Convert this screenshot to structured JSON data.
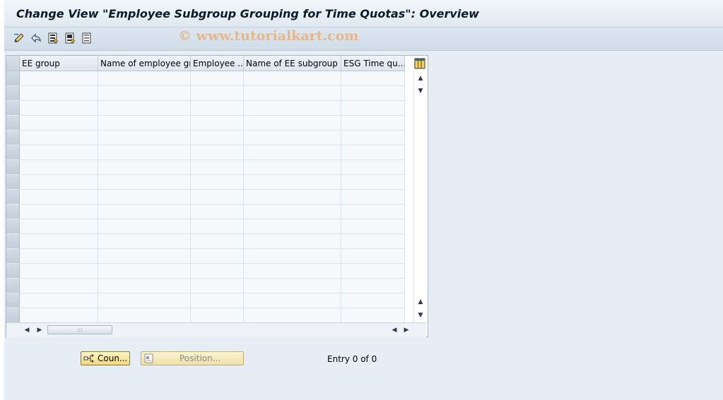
{
  "window": {
    "title": "Change View \"Employee Subgroup Grouping for Time Quotas\": Overview"
  },
  "toolbar": {
    "icons": [
      "edit-pencil-icon",
      "undo-changes-icon",
      "select-all-icon",
      "select-block-icon",
      "deselect-all-icon"
    ]
  },
  "watermark": {
    "text": "© www.tutorialkart.com"
  },
  "table": {
    "columns": [
      {
        "label": "EE group"
      },
      {
        "label": "Name of employee grp"
      },
      {
        "label": "Employee ..."
      },
      {
        "label": "Name of EE subgroup"
      },
      {
        "label": "ESG Time qu..."
      }
    ],
    "row_count": 17,
    "rows": []
  },
  "buttons": {
    "count_label": "Coun...",
    "position_label": "Position..."
  },
  "status": {
    "entry_text": "Entry 0 of 0"
  },
  "colors": {
    "background": "#e6edf5",
    "button_yellow": "#f2d77a",
    "watermark": "#e8a86c"
  }
}
